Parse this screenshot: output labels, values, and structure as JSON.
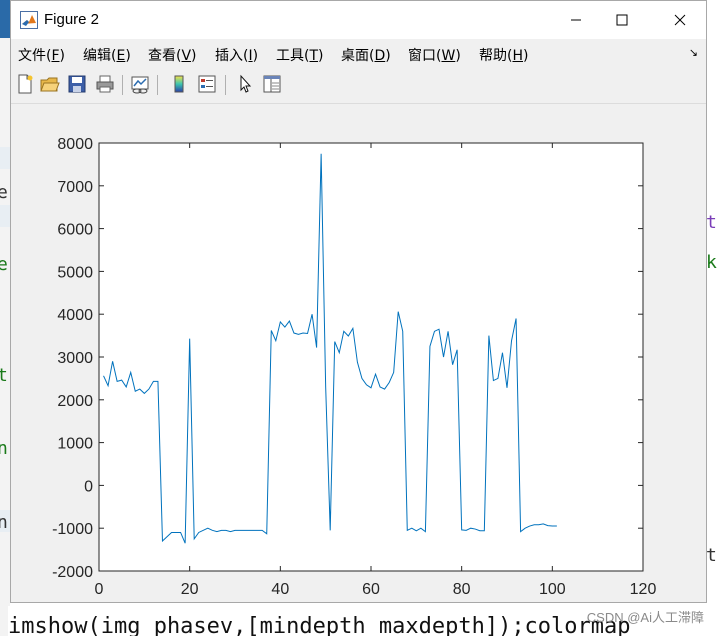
{
  "window": {
    "title": "Figure 2",
    "controls": {
      "minimize": "—",
      "maximize": "☐",
      "close": "✕"
    }
  },
  "menu": {
    "items": [
      {
        "text": "文件(",
        "key": "F",
        "end": ")"
      },
      {
        "text": "编辑(",
        "key": "E",
        "end": ")"
      },
      {
        "text": "查看(",
        "key": "V",
        "end": ")"
      },
      {
        "text": "插入(",
        "key": "I",
        "end": ")"
      },
      {
        "text": "工具(",
        "key": "T",
        "end": ")"
      },
      {
        "text": "桌面(",
        "key": "D",
        "end": ")"
      },
      {
        "text": "窗口(",
        "key": "W",
        "end": ")"
      },
      {
        "text": "帮助(",
        "key": "H",
        "end": ")"
      }
    ],
    "dock_arrow": "↘"
  },
  "toolbar": {
    "icons": [
      "new-figure-icon",
      "open-file-icon",
      "save-icon",
      "print-icon",
      "link-plot-icon",
      "colorbar-icon",
      "legend-icon",
      "select-pointer-icon",
      "property-inspector-icon"
    ]
  },
  "chart_data": {
    "type": "line",
    "title": "",
    "xlabel": "",
    "ylabel": "",
    "xlim": [
      0,
      120
    ],
    "ylim": [
      -2000,
      8000
    ],
    "xticks": [
      0,
      20,
      40,
      60,
      80,
      100,
      120
    ],
    "yticks": [
      -2000,
      -1000,
      0,
      1000,
      2000,
      3000,
      4000,
      5000,
      6000,
      7000,
      8000
    ],
    "grid": false,
    "line_color": "#0072bd",
    "series": [
      {
        "x": [
          1,
          2,
          3,
          4,
          5,
          6,
          7,
          8,
          9,
          10,
          11,
          12,
          13,
          14,
          15,
          16,
          17,
          18,
          19,
          20,
          21,
          22,
          23,
          24,
          25,
          26,
          27,
          28,
          29,
          30,
          31,
          32,
          33,
          34,
          35,
          36,
          37,
          38,
          39,
          40,
          41,
          42,
          43,
          44,
          45,
          46,
          47,
          48,
          49,
          50,
          51,
          52,
          53,
          54,
          55,
          56,
          57,
          58,
          59,
          60,
          61,
          62,
          63,
          64,
          65,
          66,
          67,
          68,
          69,
          70,
          71,
          72,
          73,
          74,
          75,
          76,
          77,
          78,
          79,
          80,
          81,
          82,
          83,
          84,
          85,
          86,
          87,
          88,
          89,
          90,
          91,
          92,
          93,
          94,
          95,
          96,
          97,
          98,
          99,
          100,
          101
        ],
        "y": [
          2560,
          2330,
          2900,
          2430,
          2460,
          2300,
          2640,
          2200,
          2250,
          2150,
          2250,
          2430,
          2430,
          -1300,
          -1200,
          -1100,
          -1100,
          -1100,
          -1350,
          3430,
          -1250,
          -1100,
          -1050,
          -1000,
          -1050,
          -1080,
          -1050,
          -1050,
          -1080,
          -1050,
          -1050,
          -1050,
          -1050,
          -1050,
          -1050,
          -1050,
          -1130,
          3620,
          3380,
          3820,
          3700,
          3840,
          3560,
          3530,
          3560,
          3550,
          4000,
          3220,
          7750,
          2300,
          -1050,
          3360,
          3100,
          3600,
          3490,
          3670,
          2880,
          2500,
          2350,
          2280,
          2600,
          2300,
          2250,
          2400,
          2640,
          4060,
          3600,
          -1050,
          -1000,
          -1060,
          -1000,
          -1080,
          3250,
          3600,
          3650,
          3000,
          3600,
          2820,
          3170,
          -1040,
          -1050,
          -1000,
          -1020,
          -1060,
          -1060,
          3500,
          2450,
          2500,
          3100,
          2280,
          3380,
          3900,
          -1080,
          -1000,
          -950,
          -920,
          -920,
          -900,
          -940,
          -950,
          -950
        ]
      }
    ]
  },
  "background": {
    "bottom_code": "imshow(img_phasev,[mindepth maxdepth]);colormap",
    "watermark": "CSDN @Ai人工滞障",
    "left_glyphs": [
      "e",
      "e",
      "t",
      "n",
      "n"
    ],
    "right_glyphs": [
      "t",
      "k",
      "t"
    ]
  }
}
